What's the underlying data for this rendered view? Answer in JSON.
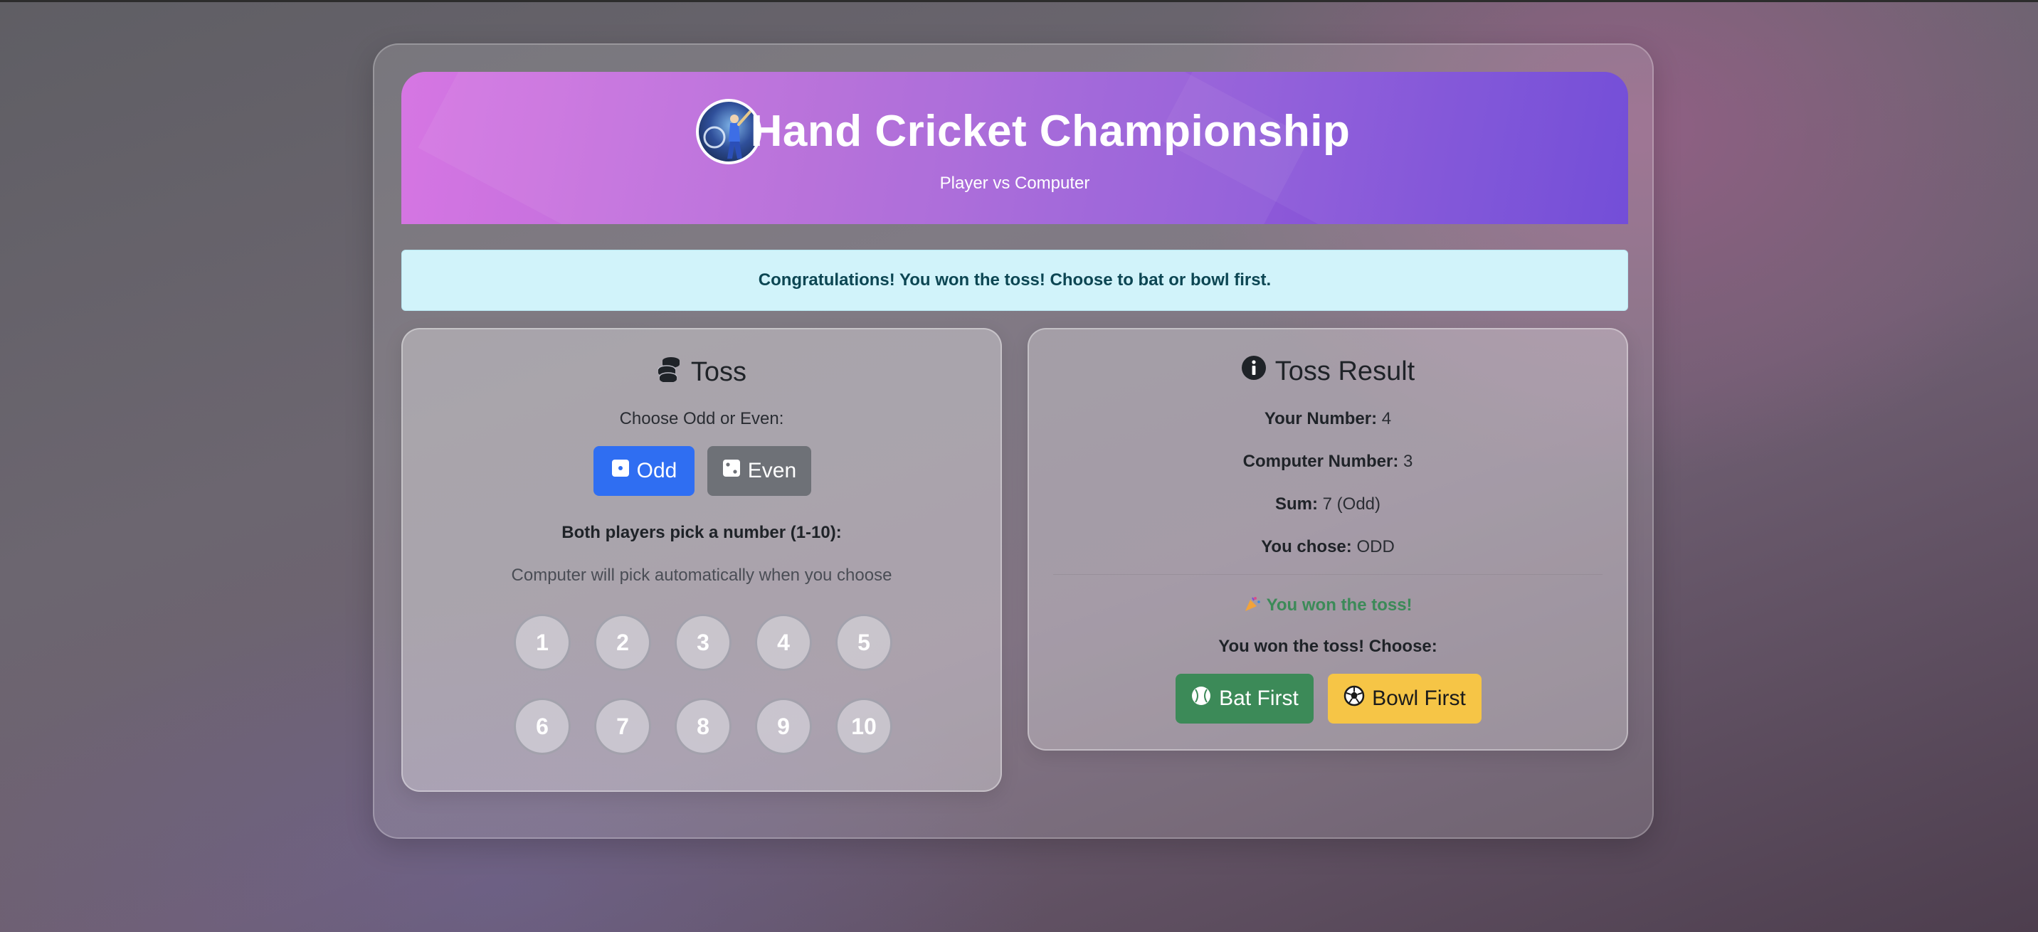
{
  "header": {
    "title": "Hand Cricket Championship",
    "subtitle": "Player vs Computer",
    "logo_icon": "cricket-player-logo"
  },
  "alert": {
    "message": "Congratulations! You won the toss! Choose to bat or bowl first."
  },
  "toss_card": {
    "title": "Toss",
    "icon": "coins-icon",
    "choose_label": "Choose Odd or Even:",
    "odd_label": "Odd",
    "even_label": "Even",
    "pick_label": "Both players pick a number (1-10):",
    "auto_note": "Computer will pick automatically when you choose",
    "numbers": [
      "1",
      "2",
      "3",
      "4",
      "5",
      "6",
      "7",
      "8",
      "9",
      "10"
    ]
  },
  "result_card": {
    "title": "Toss Result",
    "icon": "info-circle-icon",
    "your_number_label": "Your Number:",
    "your_number": "4",
    "computer_number_label": "Computer Number:",
    "computer_number": "3",
    "sum_label": "Sum:",
    "sum": "7 (Odd)",
    "you_chose_label": "You chose:",
    "you_chose": "ODD",
    "won_message": "You won the toss!",
    "choose_prompt": "You won the toss! Choose:",
    "bat_label": "Bat First",
    "bowl_label": "Bowl First"
  },
  "colors": {
    "header_start": "#d676e3",
    "header_end": "#6c45d6",
    "alert_bg": "#d1f3fa",
    "odd_button": "#2f6ef2",
    "even_button": "#6e7177",
    "bat_button": "#3c8a58",
    "bowl_button": "#f6c546",
    "won_text": "#3c8a58"
  }
}
